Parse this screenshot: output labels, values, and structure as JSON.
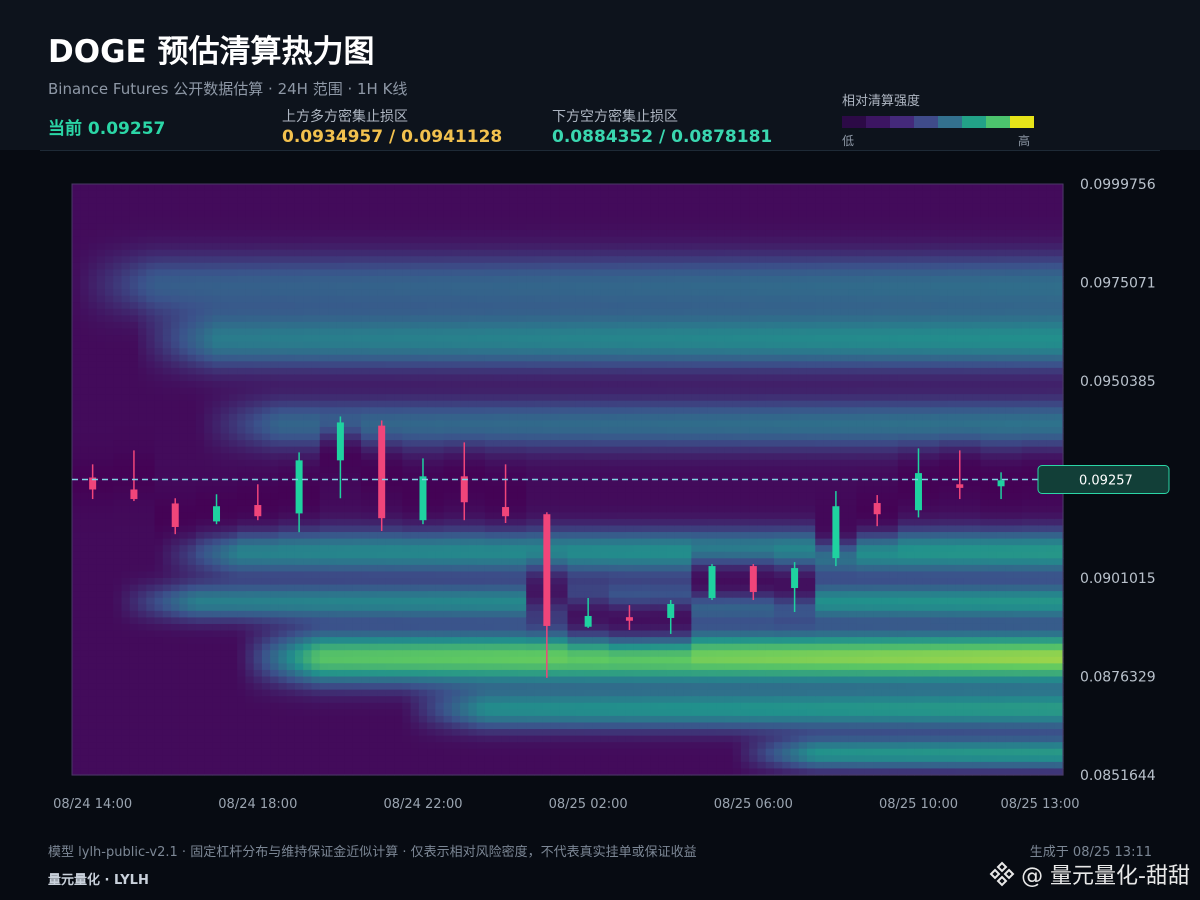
{
  "header": {
    "title": "DOGE 预估清算热力图",
    "subtitle": "Binance Futures 公开数据估算 · 24H 范围 · 1H K线",
    "current_label": "当前 0.09257",
    "upper_label": "上方多方密集止损区",
    "upper_value": "0.0934957 / 0.0941128",
    "lower_label": "下方空方密集止损区",
    "lower_value": "0.0884352 / 0.0878181"
  },
  "legend": {
    "title": "相对清算强度",
    "low": "低",
    "high": "高",
    "colors": [
      "#2c0a46",
      "#3c1562",
      "#44297a",
      "#3f4b8a",
      "#33708e",
      "#22a287",
      "#4cc36d",
      "#e7e419"
    ]
  },
  "chart_data": {
    "type": "heatmap",
    "current_price": 0.09257,
    "current_price_label": "0.09257",
    "ylim": [
      0.0851644,
      0.0999756
    ],
    "y_ticks": [
      "0.0999756",
      "0.0975071",
      "0.0950385",
      "0.0926",
      "0.0901015",
      "0.0876329",
      "0.0851644"
    ],
    "y_tick_labels": [
      "0.0999756",
      "0.0975071",
      "0.0950385",
      "",
      "0.0901015",
      "0.0876329",
      "0.0851644"
    ],
    "x_range": [
      "08/24 13:30",
      "08/25 13:30"
    ],
    "x_ticks": [
      {
        "label": "08/24 14:00",
        "hour": 0.5
      },
      {
        "label": "08/24 18:00",
        "hour": 4.5
      },
      {
        "label": "08/24 22:00",
        "hour": 8.5
      },
      {
        "label": "08/25 02:00",
        "hour": 12.5
      },
      {
        "label": "08/25 06:00",
        "hour": 16.5
      },
      {
        "label": "08/25 10:00",
        "hour": 20.5
      },
      {
        "label": "08/25 13:00",
        "hour": 23.5
      }
    ],
    "heat_bands": [
      {
        "price": 0.09745,
        "sigma": 0.00055,
        "intensity": 0.32,
        "start": 0,
        "end": 24
      },
      {
        "price": 0.09605,
        "sigma": 0.0005,
        "intensity": 0.45,
        "start": 1.5,
        "end": 24
      },
      {
        "price": 0.09395,
        "sigma": 0.00045,
        "intensity": 0.35,
        "start": 3,
        "end": 24
      },
      {
        "price": 0.09075,
        "sigma": 0.0004,
        "intensity": 0.5,
        "start": 2,
        "end": 24
      },
      {
        "price": 0.0895,
        "sigma": 0.00032,
        "intensity": 0.48,
        "start": 1,
        "end": 24
      },
      {
        "price": 0.0881,
        "sigma": 0.00045,
        "intensity": 0.82,
        "start": 4,
        "end": 24
      },
      {
        "price": 0.0868,
        "sigma": 0.00035,
        "intensity": 0.5,
        "start": 8,
        "end": 24
      },
      {
        "price": 0.0857,
        "sigma": 0.00028,
        "intensity": 0.5,
        "start": 16,
        "end": 24
      }
    ],
    "candles": [
      {
        "o": 0.09262,
        "c": 0.09232,
        "h": 0.09295,
        "l": 0.09208,
        "dir": "down"
      },
      {
        "o": 0.09232,
        "c": 0.09208,
        "h": 0.0933,
        "l": 0.09203,
        "dir": "down"
      },
      {
        "o": 0.09197,
        "c": 0.09138,
        "h": 0.0921,
        "l": 0.0912,
        "dir": "down"
      },
      {
        "o": 0.09152,
        "c": 0.0919,
        "h": 0.0922,
        "l": 0.09145,
        "dir": "up"
      },
      {
        "o": 0.09193,
        "c": 0.09165,
        "h": 0.09245,
        "l": 0.09155,
        "dir": "down"
      },
      {
        "o": 0.09172,
        "c": 0.09305,
        "h": 0.09325,
        "l": 0.09125,
        "dir": "up"
      },
      {
        "o": 0.09305,
        "c": 0.094,
        "h": 0.09415,
        "l": 0.0921,
        "dir": "up"
      },
      {
        "o": 0.09392,
        "c": 0.0916,
        "h": 0.09405,
        "l": 0.09128,
        "dir": "down"
      },
      {
        "o": 0.09155,
        "c": 0.09265,
        "h": 0.0931,
        "l": 0.09145,
        "dir": "up"
      },
      {
        "o": 0.09265,
        "c": 0.092,
        "h": 0.0935,
        "l": 0.09155,
        "dir": "down"
      },
      {
        "o": 0.09188,
        "c": 0.09165,
        "h": 0.09295,
        "l": 0.09148,
        "dir": "down"
      },
      {
        "o": 0.0917,
        "c": 0.0889,
        "h": 0.09175,
        "l": 0.0876,
        "dir": "down"
      },
      {
        "o": 0.08888,
        "c": 0.08915,
        "h": 0.0896,
        "l": 0.08885,
        "dir": "up"
      },
      {
        "o": 0.08912,
        "c": 0.08903,
        "h": 0.08942,
        "l": 0.0888,
        "dir": "down"
      },
      {
        "o": 0.0891,
        "c": 0.08945,
        "h": 0.08955,
        "l": 0.0887,
        "dir": "up"
      },
      {
        "o": 0.0896,
        "c": 0.0904,
        "h": 0.09045,
        "l": 0.08955,
        "dir": "up"
      },
      {
        "o": 0.0904,
        "c": 0.08975,
        "h": 0.09045,
        "l": 0.08955,
        "dir": "down"
      },
      {
        "o": 0.08985,
        "c": 0.09035,
        "h": 0.0905,
        "l": 0.08925,
        "dir": "up"
      },
      {
        "o": 0.0906,
        "c": 0.0919,
        "h": 0.09228,
        "l": 0.0904,
        "dir": "up"
      },
      {
        "o": 0.09198,
        "c": 0.0917,
        "h": 0.09218,
        "l": 0.0914,
        "dir": "down"
      },
      {
        "o": 0.0918,
        "c": 0.09273,
        "h": 0.09335,
        "l": 0.09162,
        "dir": "up"
      },
      {
        "o": 0.09245,
        "c": 0.09236,
        "h": 0.0933,
        "l": 0.09208,
        "dir": "down"
      },
      {
        "o": 0.0924,
        "c": 0.09255,
        "h": 0.09275,
        "l": 0.09208,
        "dir": "up"
      },
      {
        "o": 0.0925,
        "c": 0.0927,
        "h": 0.09275,
        "l": 0.0924,
        "dir": "up"
      }
    ],
    "colors": {
      "up": "#1fd2a0",
      "down": "#f0457a",
      "price_line": "#7fd4e4",
      "price_tag_bg": "#123f38",
      "price_tag_border": "#2bd6a6"
    }
  },
  "footer": {
    "note": "模型 lylh-public-v2.1 · 固定杠杆分布与维持保证金近似计算 · 仅表示相对风险密度，不代表真实挂单或保证收益",
    "generated": "生成于 08/25 13:11",
    "brand": "量元量化 · LYLH",
    "watermark": "@ 量元量化-甜甜"
  }
}
